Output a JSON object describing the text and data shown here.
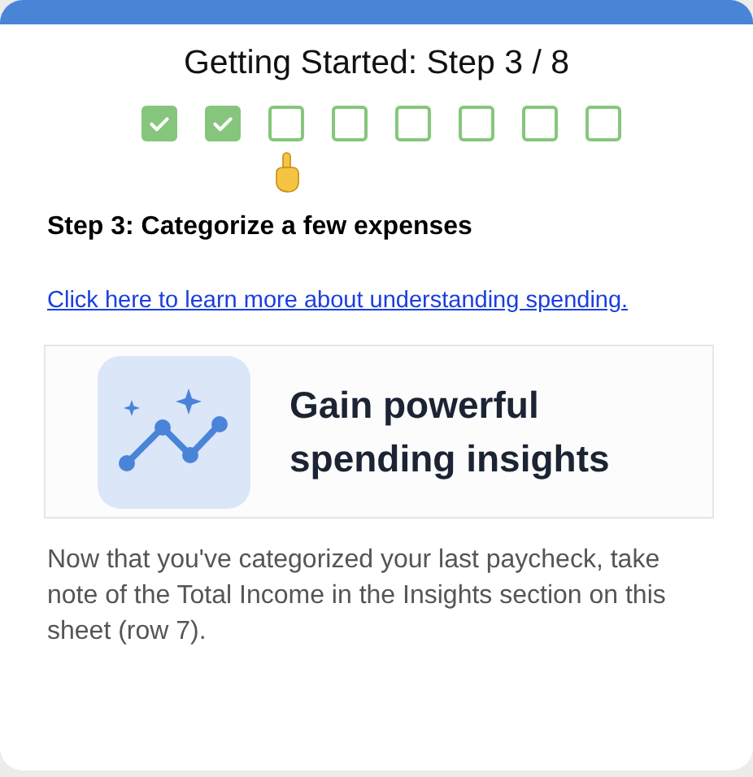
{
  "title": "Getting Started: Step 3 / 8",
  "steps": [
    {
      "checked": true,
      "current": false
    },
    {
      "checked": true,
      "current": false
    },
    {
      "checked": false,
      "current": true
    },
    {
      "checked": false,
      "current": false
    },
    {
      "checked": false,
      "current": false
    },
    {
      "checked": false,
      "current": false
    },
    {
      "checked": false,
      "current": false
    },
    {
      "checked": false,
      "current": false
    }
  ],
  "heading": "Step 3: Categorize a few expenses",
  "link": "Click here to learn more about understanding spending.",
  "banner": {
    "text": "Gain powerful spending insights"
  },
  "body": "Now that you've categorized your last paycheck, take note of the Total Income in the Insights section on this sheet (row 7)."
}
